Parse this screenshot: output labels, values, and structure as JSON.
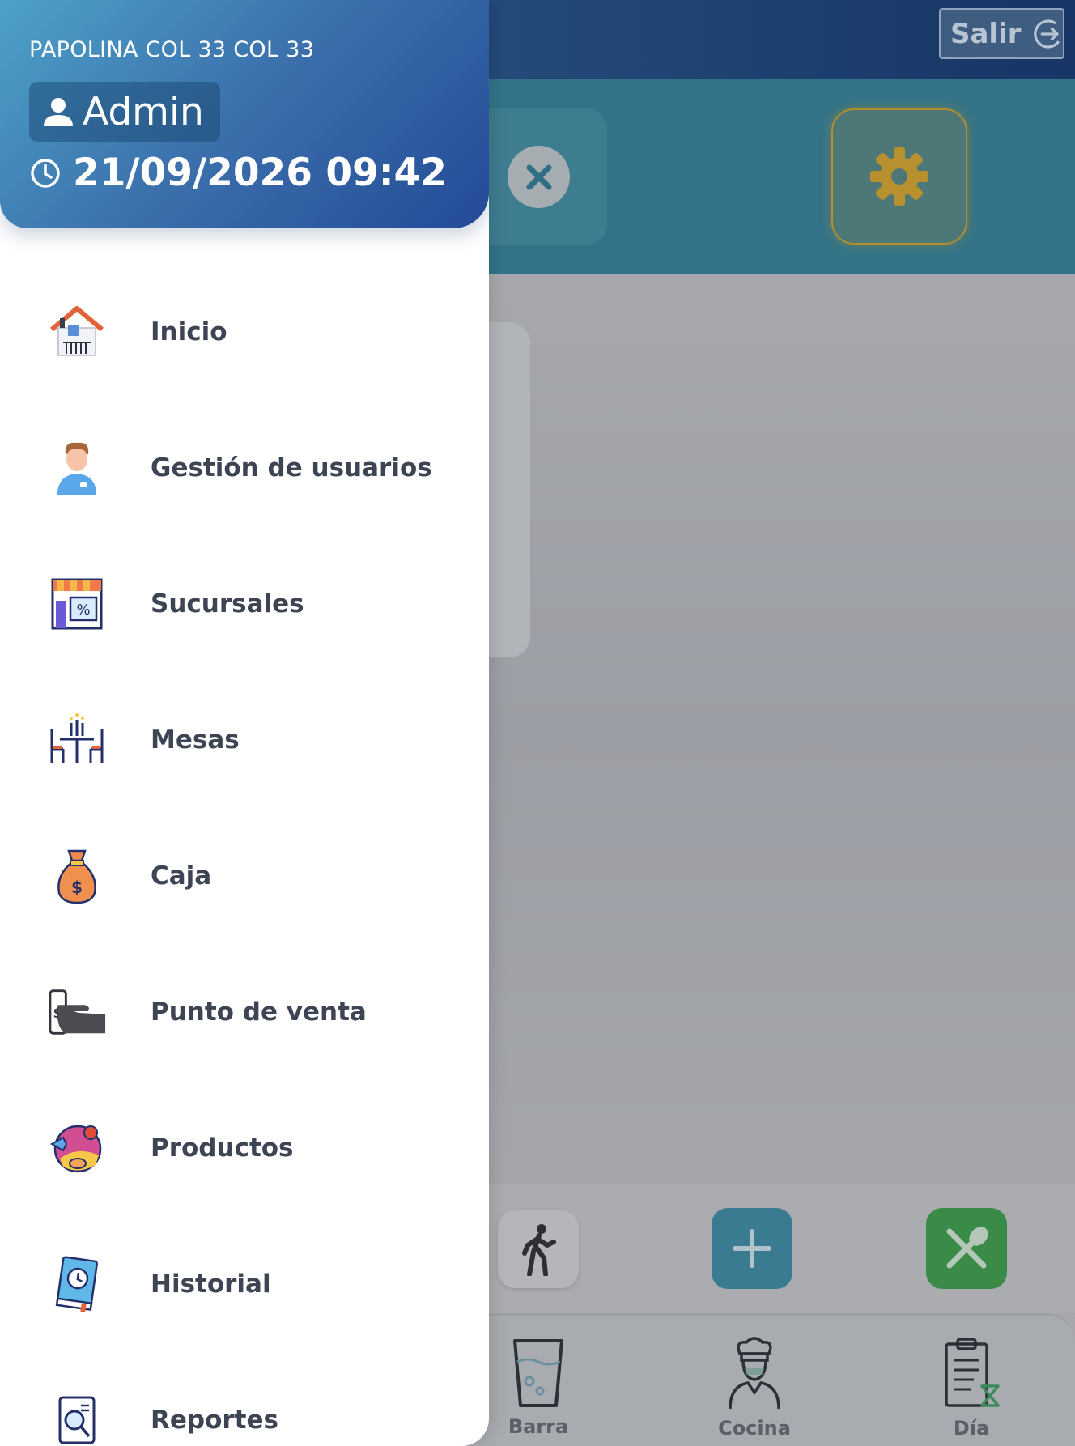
{
  "topbar": {
    "logout_label": "Salir"
  },
  "drawer": {
    "branch": "PAPOLINA COL 33 COL 33",
    "user": "Admin",
    "datetime": "21/09/2026 09:42",
    "menu": [
      {
        "label": "Inicio",
        "icon": "house-icon"
      },
      {
        "label": "Gestión de usuarios",
        "icon": "user-icon"
      },
      {
        "label": "Sucursales",
        "icon": "store-icon"
      },
      {
        "label": "Mesas",
        "icon": "table-icon"
      },
      {
        "label": "Caja",
        "icon": "money-bag-icon"
      },
      {
        "label": "Punto de venta",
        "icon": "payment-hand-icon"
      },
      {
        "label": "Productos",
        "icon": "food-plate-icon"
      },
      {
        "label": "Historial",
        "icon": "history-book-icon"
      },
      {
        "label": "Reportes",
        "icon": "report-icon"
      }
    ]
  },
  "bottom_nav": [
    {
      "label": "Barra",
      "icon": "glass-icon"
    },
    {
      "label": "Cocina",
      "icon": "chef-icon"
    },
    {
      "label": "Día",
      "icon": "clipboard-hourglass-icon"
    }
  ],
  "colors": {
    "header_start": "#4da1c9",
    "header_end": "#234a97",
    "menu_text": "#3d4555",
    "add_button": "#3a7b92",
    "food_button": "#3a8b48",
    "gear": "#b28f2c"
  }
}
